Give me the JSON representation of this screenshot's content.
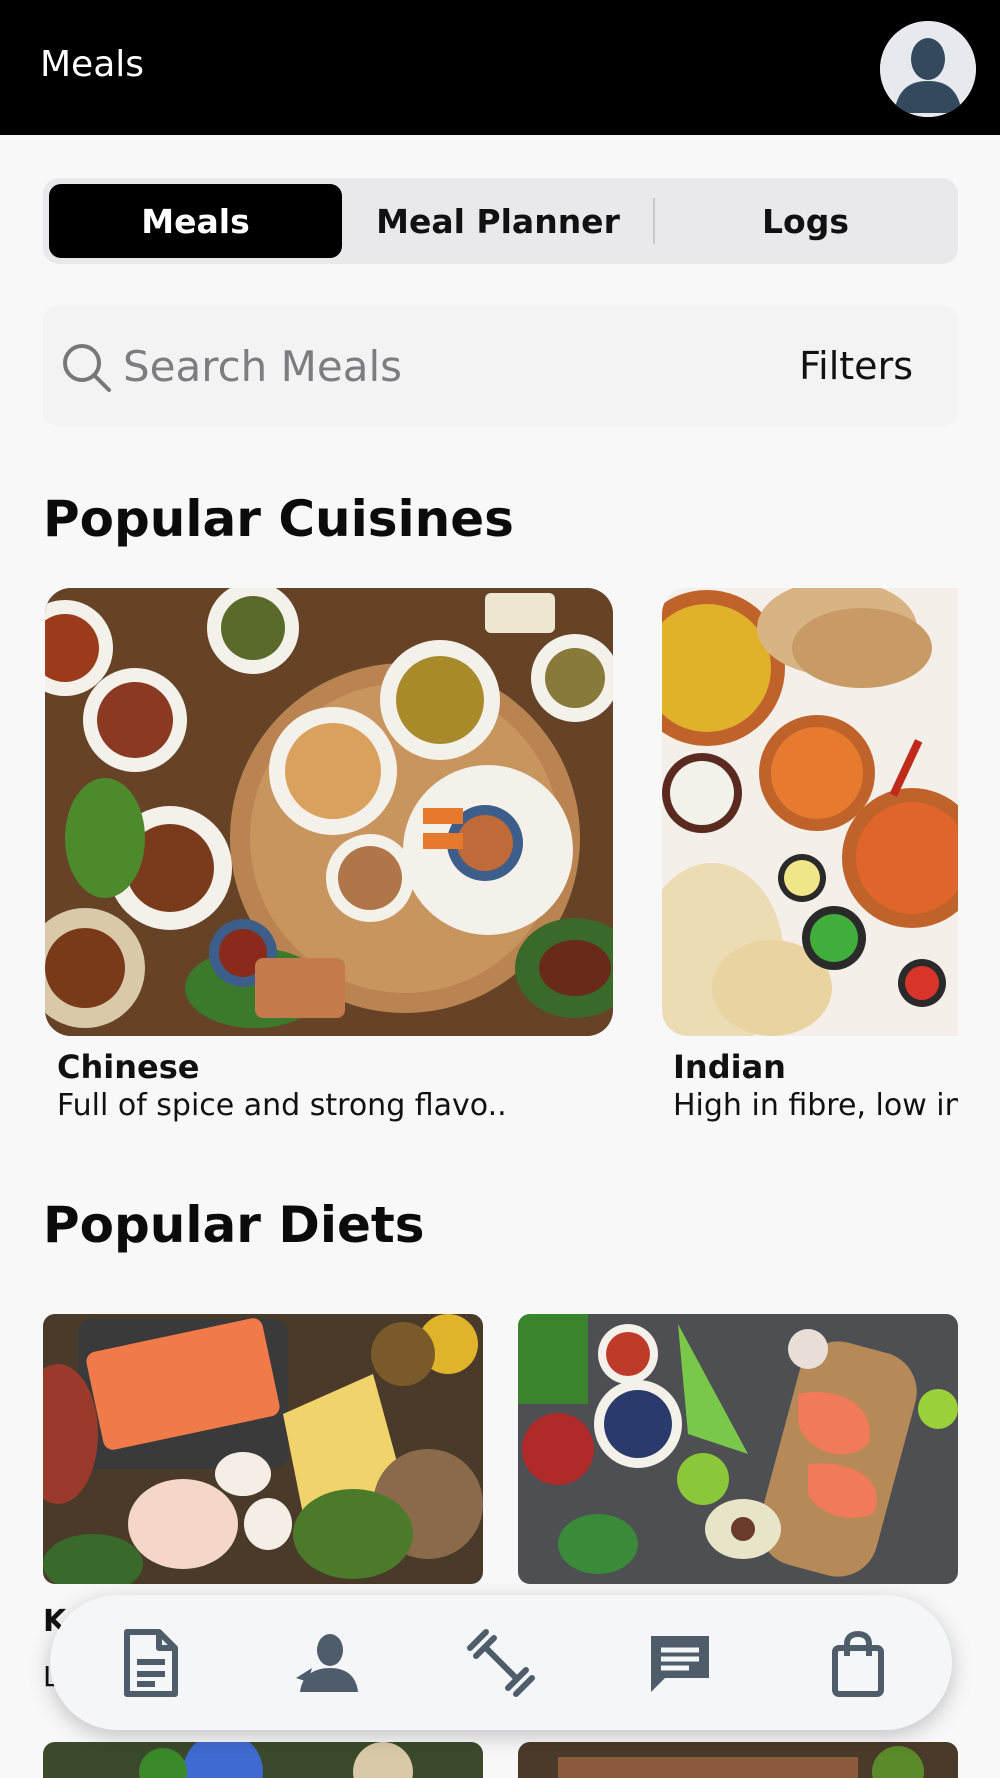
{
  "header": {
    "title": "Meals"
  },
  "tabs": [
    {
      "label": "Meals",
      "active": true
    },
    {
      "label": "Meal Planner",
      "active": false
    },
    {
      "label": "Logs",
      "active": false
    }
  ],
  "search": {
    "placeholder": "Search Meals",
    "filters_label": "Filters"
  },
  "cuisines": {
    "title": "Popular Cuisines",
    "items": [
      {
        "name": "Chinese",
        "description": "Full of spice and strong flavo.."
      },
      {
        "name": "Indian",
        "description": "High in fibre, low in"
      }
    ]
  },
  "diets": {
    "title": "Popular Diets",
    "items": [
      {
        "name": "K",
        "description": "L"
      },
      {
        "name": "",
        "description": ""
      }
    ]
  },
  "bottom_nav": [
    {
      "icon": "document-icon"
    },
    {
      "icon": "coach-icon"
    },
    {
      "icon": "dumbbell-icon"
    },
    {
      "icon": "chat-icon"
    },
    {
      "icon": "shopping-bag-icon"
    }
  ],
  "colors": {
    "header_bg": "#000000",
    "icon_gray": "#4f5d6b",
    "accent": "#000000"
  }
}
